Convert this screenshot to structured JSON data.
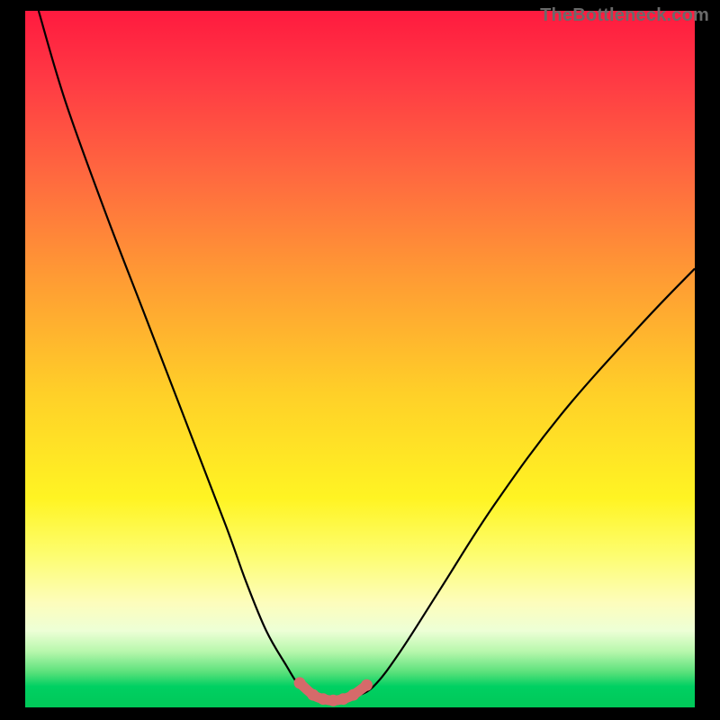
{
  "watermark": "TheBottleneck.com",
  "colors": {
    "background": "#000000",
    "curve_stroke": "#000000",
    "marker_stroke": "#d66a6a",
    "marker_fill": "#d66a6a",
    "gradient_top": "#ff1a3f",
    "gradient_bottom": "#00c858"
  },
  "chart_data": {
    "type": "line",
    "title": "",
    "xlabel": "",
    "ylabel": "",
    "xlim": [
      0,
      100
    ],
    "ylim": [
      0,
      100
    ],
    "grid": false,
    "legend": false,
    "series": [
      {
        "name": "bottleneck-curve",
        "x": [
          2,
          6,
          12,
          18,
          24,
          30,
          33,
          36,
          39,
          41,
          43,
          45,
          47,
          49,
          52,
          56,
          62,
          70,
          80,
          92,
          100
        ],
        "y": [
          100,
          87,
          71,
          56,
          41,
          26,
          18,
          11,
          6,
          3,
          1.5,
          1,
          1,
          1.5,
          3,
          8,
          17,
          29,
          42,
          55,
          63
        ]
      }
    ],
    "markers": {
      "name": "low-bottleneck-zone",
      "x": [
        41,
        43,
        44.5,
        46,
        47.5,
        49,
        51
      ],
      "y": [
        3.5,
        1.8,
        1.2,
        1.0,
        1.2,
        1.8,
        3.2
      ]
    }
  }
}
